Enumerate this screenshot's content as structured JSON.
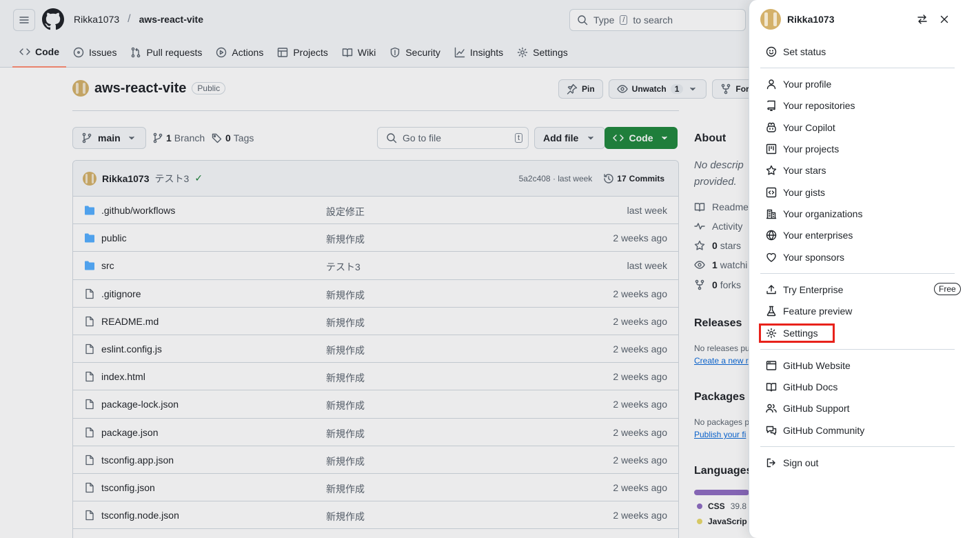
{
  "header": {
    "owner": "Rikka1073",
    "separator": "/",
    "repo": "aws-react-vite",
    "search_prefix": "Type",
    "search_key": "/",
    "search_suffix": "to search"
  },
  "tabs": [
    {
      "label": "Code"
    },
    {
      "label": "Issues"
    },
    {
      "label": "Pull requests"
    },
    {
      "label": "Actions"
    },
    {
      "label": "Projects"
    },
    {
      "label": "Wiki"
    },
    {
      "label": "Security"
    },
    {
      "label": "Insights"
    },
    {
      "label": "Settings"
    }
  ],
  "repo_head": {
    "name": "aws-react-vite",
    "visibility": "Public",
    "pin_label": "Pin",
    "unwatch_label": "Unwatch",
    "watch_count": "1",
    "fork_label": "Fork"
  },
  "toolbar": {
    "branch": "main",
    "branch_count": "1",
    "branch_label": "Branch",
    "tag_count": "0",
    "tag_label": "Tags",
    "goto_placeholder": "Go to file",
    "goto_key": "t",
    "addfile_label": "Add file",
    "code_label": "Code"
  },
  "commit": {
    "author": "Rikka1073",
    "message": "テスト3",
    "hash_time": "5a2c408 · last week",
    "commits_count": "17",
    "commits_label": "Commits"
  },
  "files": [
    {
      "type": "folder",
      "name": ".github/workflows",
      "message": "設定修正",
      "date": "last week"
    },
    {
      "type": "folder",
      "name": "public",
      "message": "新規作成",
      "date": "2 weeks ago"
    },
    {
      "type": "folder",
      "name": "src",
      "message": "テスト3",
      "date": "last week"
    },
    {
      "type": "file",
      "name": ".gitignore",
      "message": "新規作成",
      "date": "2 weeks ago"
    },
    {
      "type": "file",
      "name": "README.md",
      "message": "新規作成",
      "date": "2 weeks ago"
    },
    {
      "type": "file",
      "name": "eslint.config.js",
      "message": "新規作成",
      "date": "2 weeks ago"
    },
    {
      "type": "file",
      "name": "index.html",
      "message": "新規作成",
      "date": "2 weeks ago"
    },
    {
      "type": "file",
      "name": "package-lock.json",
      "message": "新規作成",
      "date": "2 weeks ago"
    },
    {
      "type": "file",
      "name": "package.json",
      "message": "新規作成",
      "date": "2 weeks ago"
    },
    {
      "type": "file",
      "name": "tsconfig.app.json",
      "message": "新規作成",
      "date": "2 weeks ago"
    },
    {
      "type": "file",
      "name": "tsconfig.json",
      "message": "新規作成",
      "date": "2 weeks ago"
    },
    {
      "type": "file",
      "name": "tsconfig.node.json",
      "message": "新規作成",
      "date": "2 weeks ago"
    }
  ],
  "about": {
    "title": "About",
    "desc_line1": "No descrip",
    "desc_line2": "provided.",
    "readme": "Readme",
    "activity": "Activity",
    "stars_count": "0",
    "stars_label": "stars",
    "watching_count": "1",
    "watching_label": "watchi",
    "forks_count": "0",
    "forks_label": "forks",
    "releases_title": "Releases",
    "releases_text": "No releases pu",
    "releases_link": "Create a new r",
    "packages_title": "Packages",
    "packages_text": "No packages p",
    "packages_link": "Publish your fi",
    "languages_title": "Languages",
    "lang1_name": "CSS",
    "lang1_pct": "39.8",
    "lang1_color": "#663399",
    "lang2_name": "JavaScrip",
    "lang2_color": "#f1e05a"
  },
  "menu": {
    "username": "Rikka1073",
    "set_status": "Set status",
    "your_profile": "Your profile",
    "your_repositories": "Your repositories",
    "your_copilot": "Your Copilot",
    "your_projects": "Your projects",
    "your_stars": "Your stars",
    "your_gists": "Your gists",
    "your_organizations": "Your organizations",
    "your_enterprises": "Your enterprises",
    "your_sponsors": "Your sponsors",
    "try_enterprise": "Try Enterprise",
    "free_badge": "Free",
    "feature_preview": "Feature preview",
    "settings": "Settings",
    "github_website": "GitHub Website",
    "github_docs": "GitHub Docs",
    "github_support": "GitHub Support",
    "github_community": "GitHub Community",
    "sign_out": "Sign out"
  },
  "colors": {
    "accent_green": "#1f883d",
    "highlight_red": "#e8221b",
    "tab_underline": "#fd8c73",
    "folder_blue": "#54aeff"
  }
}
